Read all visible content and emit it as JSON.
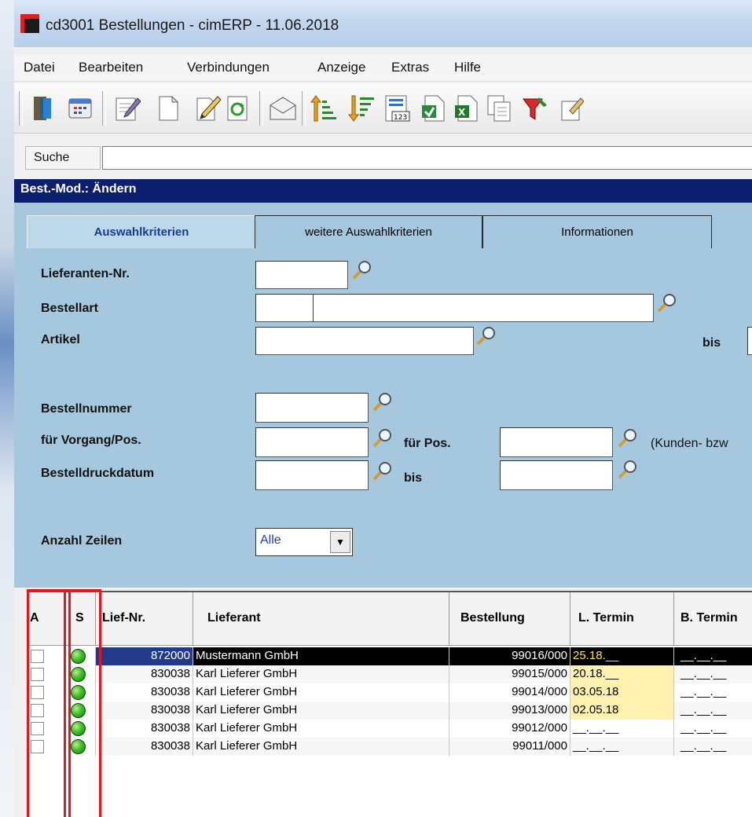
{
  "window": {
    "title": "cd3001 Bestellungen - cimERP - 11.06.2018"
  },
  "menu": [
    "Datei",
    "Bearbeiten",
    "Verbindungen",
    "Anzeige",
    "Extras",
    "Hilfe"
  ],
  "search": {
    "label": "Suche",
    "value": ""
  },
  "mode": {
    "label": "Best.-Mod.: Ändern"
  },
  "tabs": [
    {
      "label": "Auswahlkriterien",
      "active": true
    },
    {
      "label": "weitere Auswahlkriterien",
      "active": false
    },
    {
      "label": "Informationen",
      "active": false
    }
  ],
  "form": {
    "lieferanten_nr": "Lieferanten-Nr.",
    "bestellart": "Bestellart",
    "artikel": "Artikel",
    "bis_label": "bis",
    "bestellnummer": "Bestellnummer",
    "vorgang": "für Vorgang/Pos.",
    "fuer_pos": "für Pos.",
    "kunden_note": "(Kunden- bzw",
    "bestelldruckdatum": "Bestelldruckdatum",
    "bis_label2": "bis",
    "anzahl_zeilen": "Anzahl Zeilen",
    "anzahl_value": "Alle"
  },
  "table": {
    "columns": [
      "A",
      "S",
      "Lief-Nr.",
      "Lieferant",
      "Bestellung",
      "L. Termin",
      "B. Termin"
    ],
    "rows": [
      {
        "lief_nr": "872000",
        "lieferant": "Mustermann GmbH",
        "bestellung": "99016/000",
        "l_termin": "25.18.__",
        "b_termin": "__.__.__",
        "selected": true,
        "highlight": true
      },
      {
        "lief_nr": "830038",
        "lieferant": "Karl Lieferer GmbH",
        "bestellung": "99015/000",
        "l_termin": "20.18.__",
        "b_termin": "__.__.__",
        "selected": false,
        "highlight": true
      },
      {
        "lief_nr": "830038",
        "lieferant": "Karl Lieferer GmbH",
        "bestellung": "99014/000",
        "l_termin": "03.05.18",
        "b_termin": "__.__.__",
        "selected": false,
        "highlight": true
      },
      {
        "lief_nr": "830038",
        "lieferant": "Karl Lieferer GmbH",
        "bestellung": "99013/000",
        "l_termin": "02.05.18",
        "b_termin": "__.__.__",
        "selected": false,
        "highlight": true
      },
      {
        "lief_nr": "830038",
        "lieferant": "Karl Lieferer GmbH",
        "bestellung": "99012/000",
        "l_termin": "__.__.__",
        "b_termin": "__.__.__",
        "selected": false,
        "highlight": false
      },
      {
        "lief_nr": "830038",
        "lieferant": "Karl Lieferer GmbH",
        "bestellung": "99011/000",
        "l_termin": "__.__.__",
        "b_termin": "__.__.__",
        "selected": false,
        "highlight": false
      }
    ]
  },
  "colors": {
    "panel": "#a6c8df",
    "modebar": "#0c1e6e",
    "highlight_box": "#e8141e",
    "yellow": "#fff2b0",
    "status_ok": "#3fc02a"
  }
}
